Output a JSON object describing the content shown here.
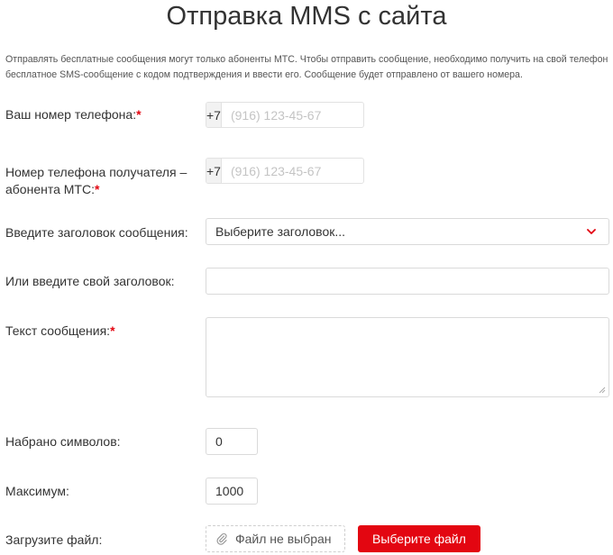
{
  "page": {
    "title": "Отправка MMS с сайта",
    "intro_line1": "Отправлять бесплатные сообщения могут только абоненты МТС. Чтобы отправить сообщение, необходимо получить на свой телефон",
    "intro_line2": "бесплатное SMS-сообщение с кодом подтверждения и ввести его. Сообщение будет отправлено от вашего номера."
  },
  "form": {
    "sender_phone": {
      "label": "Ваш номер телефона:",
      "required_mark": "*",
      "prefix": "+7",
      "placeholder": "(916) 123-45-67",
      "value": ""
    },
    "recipient_phone": {
      "label_line1": "Номер телефона получателя –",
      "label_line2": "абонента МТС:",
      "required_mark": "*",
      "prefix": "+7",
      "placeholder": "(916) 123-45-67",
      "value": ""
    },
    "subject_select": {
      "label": "Введите заголовок сообщения:",
      "selected": "Выберите заголовок..."
    },
    "custom_subject": {
      "label": "Или введите свой заголовок:",
      "value": ""
    },
    "message": {
      "label": "Текст сообщения:",
      "required_mark": "*",
      "value": ""
    },
    "typed_count": {
      "label": "Набрано символов:",
      "value": "0"
    },
    "max_count": {
      "label": "Максимум:",
      "value": "1000"
    },
    "file_upload": {
      "label": "Загрузите файл:",
      "status": "Файл не выбран",
      "button_label": "Выберите файл"
    }
  },
  "colors": {
    "accent": "#e30611",
    "border": "#dadada",
    "placeholder": "#c4c4c4",
    "prefix_bg": "#f2f2f2"
  },
  "icons": {
    "select": "chevron-down-icon",
    "file": "paperclip-icon",
    "textarea": "resize-grip-icon"
  }
}
